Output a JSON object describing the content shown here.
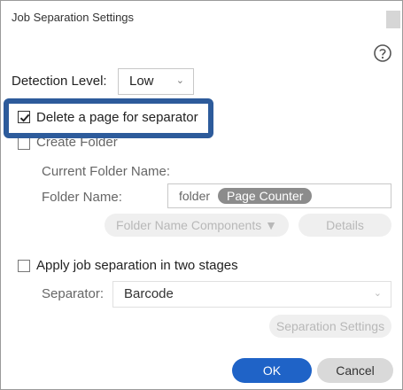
{
  "window": {
    "title": "Job Separation Settings"
  },
  "detection": {
    "label": "Detection Level:",
    "value": "Low"
  },
  "delete_page": {
    "label": "Delete a page for separator",
    "checked": true
  },
  "create_folder": {
    "label": "Create Folder",
    "current_folder_name_label": "Current Folder Name:",
    "folder_name_label": "Folder Name:",
    "folder_name_text": "folder",
    "folder_name_token": "Page Counter",
    "folder_name_components_label": "Folder Name Components",
    "details_label": "Details"
  },
  "two_stage": {
    "label": "Apply job separation in two stages",
    "separator_label": "Separator:",
    "separator_value": "Barcode",
    "separation_settings_label": "Separation Settings"
  },
  "footer": {
    "ok_label": "OK",
    "cancel_label": "Cancel"
  },
  "colors": {
    "highlight": "#2d5b9b",
    "primary": "#1f63c7"
  }
}
